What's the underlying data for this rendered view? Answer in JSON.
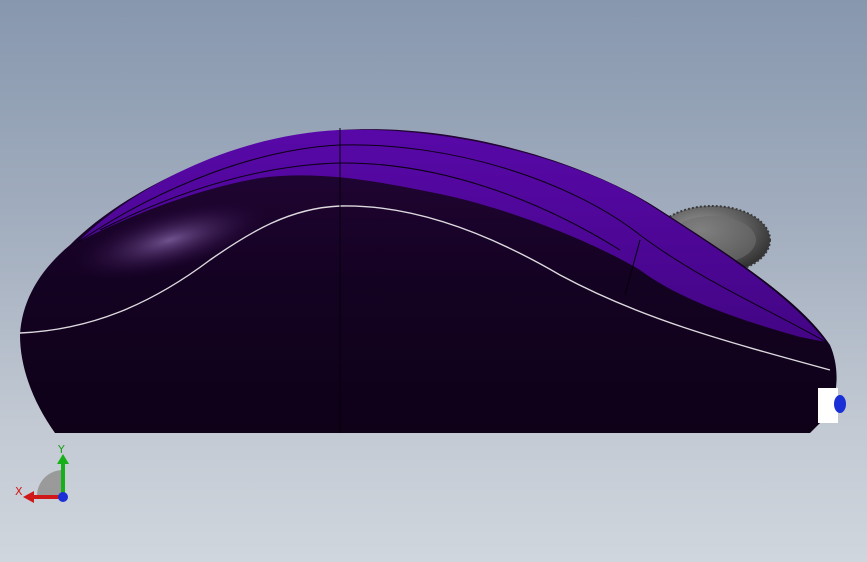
{
  "viewport": {
    "background_top": "#8797ae",
    "background_bottom": "#d0d6dd"
  },
  "model": {
    "name": "mouse-side-view",
    "body_color": "#4b0590",
    "shell_color": "#13021f",
    "wheel_color": "#5e5e5e"
  },
  "triad": {
    "x_label": "X",
    "y_label": "Y",
    "x_color": "#d01818",
    "y_color": "#18a018",
    "z_color": "#1a2fd6"
  }
}
